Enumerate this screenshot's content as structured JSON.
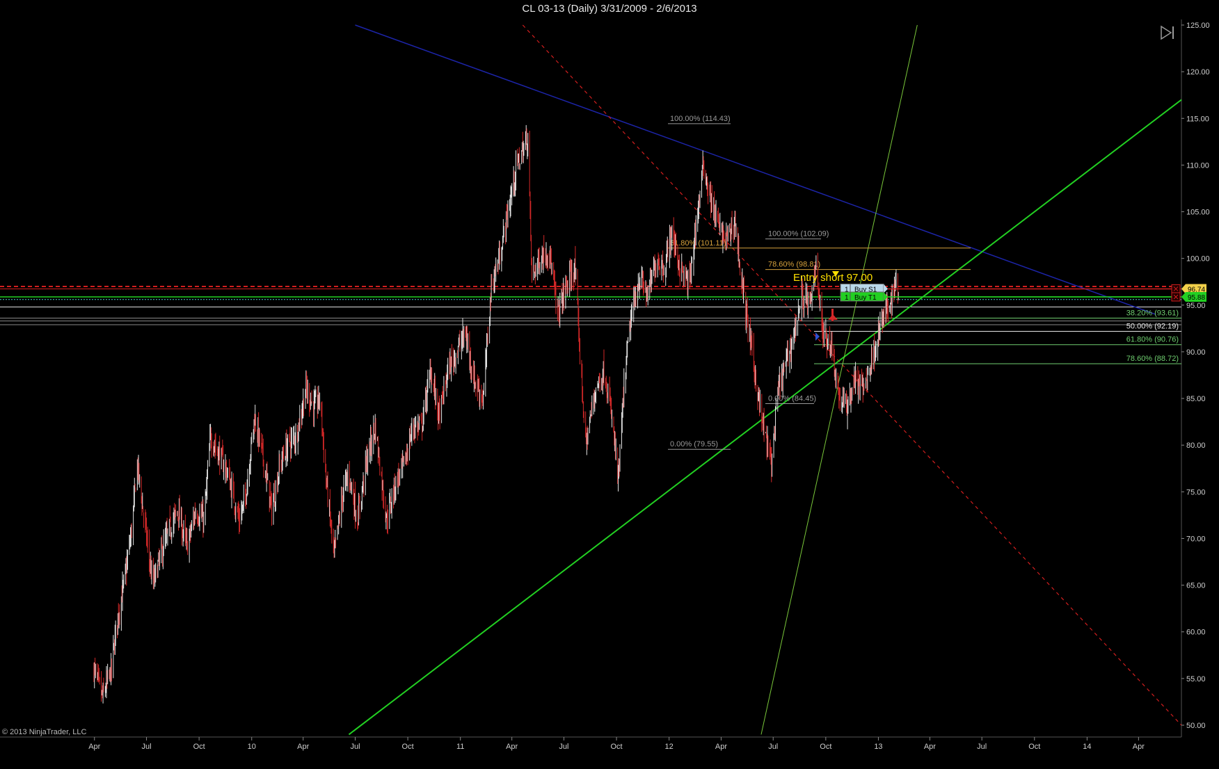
{
  "header": {
    "title": "CL 03-13 (Daily)  3/31/2009 - 2/6/2013"
  },
  "footer": {
    "copyright": "© 2013 NinjaTrader, LLC"
  },
  "icons": {
    "play_end": "skip-to-end-icon"
  },
  "colors": {
    "background": "#000000",
    "up_bar": "#e6e6e6",
    "down_bar": "#d42828",
    "downtrend_line": "#1c24a8",
    "red_dashed": "#d21e1e",
    "green_support": "#22d022",
    "green_steep": "#7ac83a",
    "fib_gray": "#9a9a9a",
    "fib_orange": "#d7a23c",
    "fib_green": "#6fce6f",
    "entry_text": "#ffe000"
  },
  "chart_data": {
    "type": "candlestick",
    "symbol": "CL 03-13",
    "interval": "Daily",
    "date_range": [
      "2009-03-31",
      "2013-02-06"
    ],
    "ylim": [
      50,
      125
    ],
    "y_ticks": [
      "125.00",
      "120.00",
      "115.00",
      "110.00",
      "105.00",
      "100.00",
      "95.00",
      "90.00",
      "85.00",
      "80.00",
      "75.00",
      "70.00",
      "65.00",
      "60.00",
      "55.00",
      "50.00"
    ],
    "x_range": [
      "2009-03-25",
      "2014-06-15"
    ],
    "x_ticks": [
      {
        "label": "Apr",
        "date": "2009-04-01"
      },
      {
        "label": "Jul",
        "date": "2009-07-01"
      },
      {
        "label": "Oct",
        "date": "2009-10-01"
      },
      {
        "label": "10",
        "date": "2010-01-01"
      },
      {
        "label": "Apr",
        "date": "2010-04-01"
      },
      {
        "label": "Jul",
        "date": "2010-07-01"
      },
      {
        "label": "Oct",
        "date": "2010-10-01"
      },
      {
        "label": "11",
        "date": "2011-01-01"
      },
      {
        "label": "Apr",
        "date": "2011-04-01"
      },
      {
        "label": "Jul",
        "date": "2011-07-01"
      },
      {
        "label": "Oct",
        "date": "2011-10-01"
      },
      {
        "label": "12",
        "date": "2012-01-01"
      },
      {
        "label": "Apr",
        "date": "2012-04-01"
      },
      {
        "label": "Jul",
        "date": "2012-07-01"
      },
      {
        "label": "Oct",
        "date": "2012-10-01"
      },
      {
        "label": "13",
        "date": "2013-01-01"
      },
      {
        "label": "Apr",
        "date": "2013-04-01"
      },
      {
        "label": "Jul",
        "date": "2013-07-01"
      },
      {
        "label": "Oct",
        "date": "2013-10-01"
      },
      {
        "label": "14",
        "date": "2014-01-01"
      },
      {
        "label": "Apr",
        "date": "2014-04-01"
      }
    ],
    "price_path": [
      [
        "2009-03-31",
        56
      ],
      [
        "2009-04-15",
        53
      ],
      [
        "2009-05-01",
        56
      ],
      [
        "2009-05-10",
        61
      ],
      [
        "2009-05-25",
        66
      ],
      [
        "2009-06-05",
        71
      ],
      [
        "2009-06-15",
        78
      ],
      [
        "2009-06-25",
        73
      ],
      [
        "2009-07-12",
        65
      ],
      [
        "2009-07-25",
        68
      ],
      [
        "2009-08-10",
        71
      ],
      [
        "2009-08-25",
        73
      ],
      [
        "2009-09-10",
        69
      ],
      [
        "2009-09-25",
        73
      ],
      [
        "2009-10-10",
        72
      ],
      [
        "2009-10-21",
        81
      ],
      [
        "2009-11-05",
        79
      ],
      [
        "2009-11-20",
        77
      ],
      [
        "2009-12-10",
        72
      ],
      [
        "2009-12-20",
        74
      ],
      [
        "2010-01-06",
        83
      ],
      [
        "2010-01-20",
        79
      ],
      [
        "2010-02-05",
        73
      ],
      [
        "2010-02-20",
        78
      ],
      [
        "2010-03-05",
        80
      ],
      [
        "2010-03-20",
        81
      ],
      [
        "2010-04-06",
        86
      ],
      [
        "2010-04-20",
        84
      ],
      [
        "2010-05-01",
        85
      ],
      [
        "2010-05-10",
        77
      ],
      [
        "2010-05-25",
        68
      ],
      [
        "2010-06-10",
        75
      ],
      [
        "2010-06-20",
        77
      ],
      [
        "2010-07-05",
        72
      ],
      [
        "2010-07-20",
        78
      ],
      [
        "2010-08-05",
        82
      ],
      [
        "2010-08-25",
        72
      ],
      [
        "2010-09-10",
        76
      ],
      [
        "2010-09-25",
        78
      ],
      [
        "2010-10-10",
        82
      ],
      [
        "2010-10-25",
        82
      ],
      [
        "2010-11-10",
        88
      ],
      [
        "2010-11-25",
        83
      ],
      [
        "2010-12-10",
        88
      ],
      [
        "2010-12-25",
        90
      ],
      [
        "2011-01-10",
        92
      ],
      [
        "2011-01-25",
        87
      ],
      [
        "2011-02-10",
        85
      ],
      [
        "2011-02-24",
        97
      ],
      [
        "2011-03-10",
        100
      ],
      [
        "2011-03-25",
        105
      ],
      [
        "2011-04-10",
        110
      ],
      [
        "2011-04-29",
        113
      ],
      [
        "2011-05-06",
        98
      ],
      [
        "2011-05-20",
        100
      ],
      [
        "2011-06-05",
        101
      ],
      [
        "2011-06-20",
        94
      ],
      [
        "2011-07-05",
        97
      ],
      [
        "2011-07-20",
        99
      ],
      [
        "2011-08-08",
        80
      ],
      [
        "2011-08-25",
        86
      ],
      [
        "2011-09-10",
        88
      ],
      [
        "2011-09-25",
        82
      ],
      [
        "2011-10-04",
        76
      ],
      [
        "2011-10-15",
        87
      ],
      [
        "2011-10-25",
        93
      ],
      [
        "2011-11-10",
        98
      ],
      [
        "2011-11-25",
        96
      ],
      [
        "2011-12-10",
        100
      ],
      [
        "2011-12-25",
        99
      ],
      [
        "2012-01-05",
        103
      ],
      [
        "2012-01-20",
        99
      ],
      [
        "2012-02-05",
        97
      ],
      [
        "2012-02-20",
        105
      ],
      [
        "2012-03-01",
        110
      ],
      [
        "2012-03-15",
        106
      ],
      [
        "2012-03-30",
        103
      ],
      [
        "2012-04-10",
        102
      ],
      [
        "2012-04-25",
        104
      ],
      [
        "2012-05-10",
        96
      ],
      [
        "2012-05-25",
        90
      ],
      [
        "2012-06-10",
        83
      ],
      [
        "2012-06-28",
        78
      ],
      [
        "2012-07-10",
        86
      ],
      [
        "2012-07-25",
        89
      ],
      [
        "2012-08-10",
        93
      ],
      [
        "2012-08-20",
        96
      ],
      [
        "2012-09-05",
        95
      ],
      [
        "2012-09-14",
        100
      ],
      [
        "2012-09-25",
        92
      ],
      [
        "2012-10-10",
        91
      ],
      [
        "2012-10-25",
        85
      ],
      [
        "2012-11-07",
        84
      ],
      [
        "2012-11-20",
        87
      ],
      [
        "2012-12-05",
        86
      ],
      [
        "2012-12-20",
        89
      ],
      [
        "2013-01-05",
        93
      ],
      [
        "2013-01-20",
        95
      ],
      [
        "2013-02-01",
        97.5
      ],
      [
        "2013-02-06",
        96.5
      ]
    ],
    "horizontal_levels": [
      {
        "price": 97.0,
        "style": "red-dashed"
      },
      {
        "price": 96.74,
        "style": "red-solid"
      },
      {
        "price": 95.88,
        "style": "green-solid"
      },
      {
        "price": 95.6,
        "style": "cyan-dotted"
      },
      {
        "price": 94.8,
        "style": "white-thin"
      },
      {
        "price": 93.61,
        "style": "gray-thin"
      },
      {
        "price": 93.3,
        "style": "gray-thin"
      },
      {
        "price": 92.9,
        "style": "gray-thin"
      }
    ],
    "trend_lines": [
      {
        "name": "downtrend",
        "color": "blue",
        "from": [
          "2010-07-01",
          125
        ],
        "to": [
          "2014-05-01",
          94
        ]
      },
      {
        "name": "red-dashed-downtrend",
        "color": "red",
        "dashed": true,
        "from": [
          "2011-04-20",
          125
        ],
        "to": [
          "2014-06-15",
          50
        ]
      },
      {
        "name": "green-support",
        "color": "green",
        "from": [
          "2010-06-20",
          49
        ],
        "to": [
          "2014-06-15",
          117
        ]
      },
      {
        "name": "steep-green",
        "color": "lightgreen",
        "from": [
          "2012-06-10",
          49
        ],
        "to": [
          "2013-03-10",
          125
        ]
      }
    ],
    "fib_sets": [
      {
        "levels": [
          {
            "label": "100.00% (114.43)",
            "price": 114.43,
            "color": "gray"
          },
          {
            "label": "61.80% (101.11)",
            "price": 101.11,
            "color": "orange"
          },
          {
            "label": "0.00% (79.55)",
            "price": 79.55,
            "color": "gray"
          }
        ]
      },
      {
        "levels": [
          {
            "label": "100.00% (102.09)",
            "price": 102.09,
            "color": "gray"
          },
          {
            "label": "78.60% (98.81)",
            "price": 98.81,
            "color": "orange"
          },
          {
            "label": "0.00% (84.45)",
            "price": 84.45,
            "color": "gray"
          }
        ]
      },
      {
        "levels": [
          {
            "label": "38.20% (93.61)",
            "price": 93.61,
            "color": "green"
          },
          {
            "label": "50.00% (92.19)",
            "price": 92.19,
            "color": "white"
          },
          {
            "label": "61.80% (90.76)",
            "price": 90.76,
            "color": "green"
          },
          {
            "label": "78.60% (88.72)",
            "price": 88.72,
            "color": "green"
          }
        ]
      }
    ],
    "annotations": {
      "entry_text": "Entry short 97.00",
      "orders": [
        {
          "qty": "1",
          "name": "Buy S1",
          "price": 96.74
        },
        {
          "qty": "1",
          "name": "Buy T1",
          "price": 95.88
        }
      ],
      "price_markers": [
        "96.74",
        "95.88"
      ]
    }
  }
}
